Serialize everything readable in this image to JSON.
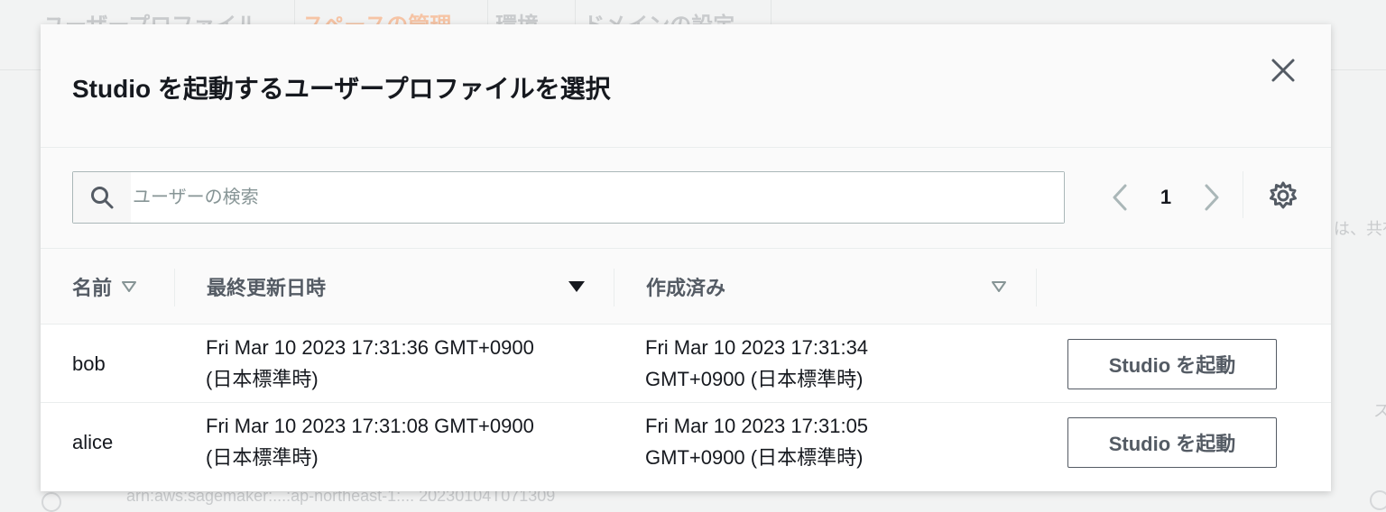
{
  "background": {
    "tabs": [
      "ユーザープロファイル",
      "スペースの管理",
      "環境",
      "ドメインの設定"
    ],
    "side_text": "は、共有",
    "side_text2": "ス",
    "blur_text": "arn:aws:sagemaker:...:ap-northeast-1:... 20230104T071309"
  },
  "modal": {
    "title": "Studio を起動するユーザープロファイルを選択",
    "search": {
      "placeholder": "ユーザーの検索",
      "value": ""
    },
    "pagination": {
      "current_page": "1"
    },
    "columns": {
      "name": "名前",
      "last_modified": "最終更新日時",
      "created": "作成済み"
    },
    "rows": [
      {
        "name": "bob",
        "last_modified": [
          "Fri Mar 10 2023 17:31:36 GMT+0900",
          "(日本標準時)"
        ],
        "created": [
          "Fri Mar 10 2023 17:31:34",
          "GMT+0900 (日本標準時)"
        ],
        "button": "Studio を起動"
      },
      {
        "name": "alice",
        "last_modified": [
          "Fri Mar 10 2023 17:31:08 GMT+0900",
          "(日本標準時)"
        ],
        "created": [
          "Fri Mar 10 2023 17:31:05",
          "GMT+0900 (日本標準時)"
        ],
        "button": "Studio を起動"
      }
    ]
  },
  "colors": {
    "text": "#16191f",
    "secondary_text": "#545b64",
    "border": "#aab7b8",
    "icon": "#545b64"
  },
  "icons": {
    "close": "close-icon",
    "search": "search-icon",
    "prev": "chevron-left-icon",
    "next": "chevron-right-icon",
    "settings": "gear-icon",
    "sort": "sort-caret-icon"
  }
}
